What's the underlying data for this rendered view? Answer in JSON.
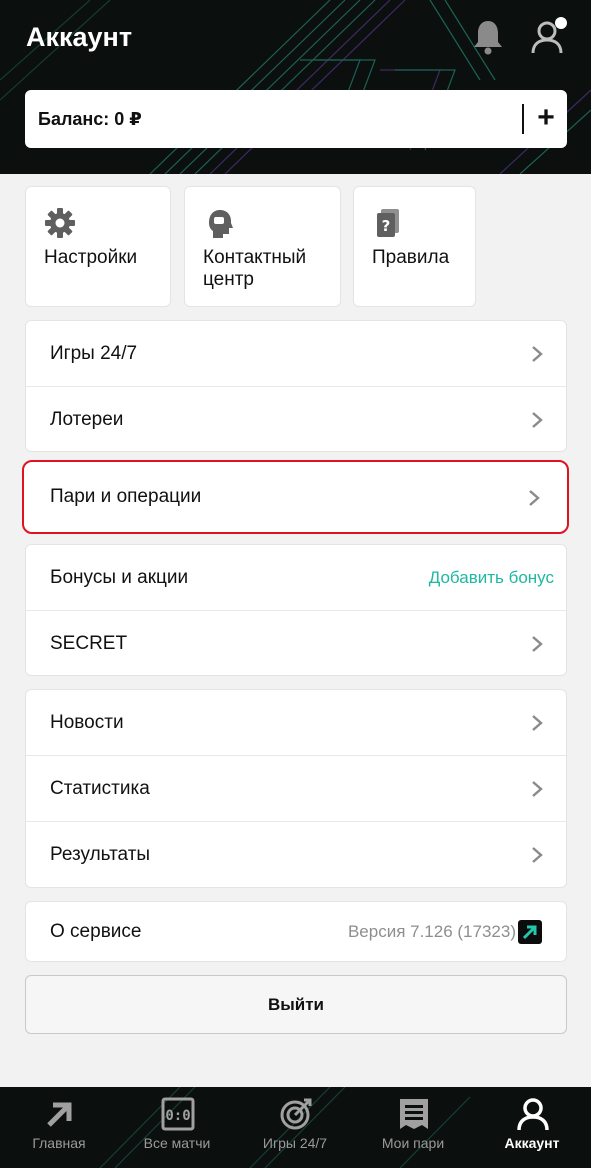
{
  "header": {
    "title": "Аккаунт",
    "balance_label": "Баланс: 0 ₽",
    "add_label": "+"
  },
  "tiles": [
    {
      "label": "Настройки",
      "icon": "gear-icon"
    },
    {
      "label": "Контактный центр",
      "icon": "chat-head-icon"
    },
    {
      "label": "Правила",
      "icon": "rules-document-icon"
    }
  ],
  "menu_group1": [
    {
      "label": "Игры 24/7"
    },
    {
      "label": "Лотереи"
    }
  ],
  "highlighted_item": {
    "label": "Пари и операции"
  },
  "menu_group2": {
    "bonus_label": "Бонусы и акции",
    "bonus_action": "Добавить бонус",
    "secret_label": "SECRET"
  },
  "menu_group3": [
    {
      "label": "Новости"
    },
    {
      "label": "Статистика"
    },
    {
      "label": "Результаты"
    }
  ],
  "about": {
    "label": "О сервисе",
    "version": "Версия 7.126 (17323)"
  },
  "logout_label": "Выйти",
  "bottom_nav": [
    {
      "label": "Главная",
      "icon": "logo-arrow-icon"
    },
    {
      "label": "Все матчи",
      "icon": "scoreboard-icon"
    },
    {
      "label": "Игры 24/7",
      "icon": "target-icon"
    },
    {
      "label": "Мои пари",
      "icon": "receipt-icon"
    },
    {
      "label": "Аккаунт",
      "icon": "user-icon",
      "active": true
    }
  ],
  "colors": {
    "accent": "#1fb8a2",
    "highlight_border": "#e0121f",
    "header_bg": "#0b0f0e"
  }
}
